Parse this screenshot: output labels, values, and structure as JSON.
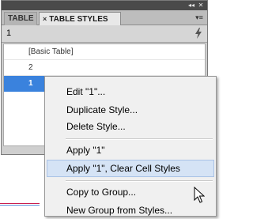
{
  "panel": {
    "window_controls": {
      "collapse": "◂◂",
      "close": "✕"
    },
    "tabs": [
      {
        "label": "TABLE"
      },
      {
        "label": "TABLE STYLES",
        "close": "×"
      }
    ],
    "menu_button": "▾≡",
    "current_style": "1",
    "styles": [
      "[Basic Table]",
      "2",
      "1"
    ],
    "selected_style": "1"
  },
  "context_menu": {
    "items": [
      "Edit \"1\"...",
      "Duplicate Style...",
      "Delete Style...",
      "Apply \"1\"",
      "Apply \"1\", Clear Cell Styles",
      "Copy to Group...",
      "New Group from Styles..."
    ],
    "hovered_item": "Apply \"1\", Clear Cell Styles"
  },
  "colors": {
    "selection": "#3a82dd",
    "hover_bg": "#d5e3f5",
    "guide_magenta": "#c9184a"
  }
}
